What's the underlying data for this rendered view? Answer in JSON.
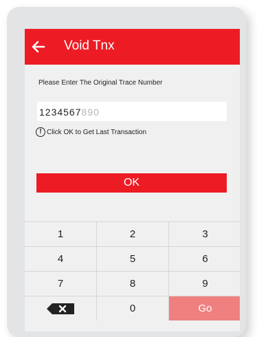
{
  "header": {
    "title": "Void Tnx",
    "back_icon": "arrow-left-icon",
    "color": "#ed1c24"
  },
  "form": {
    "prompt": "Please Enter The Original Trace Number",
    "value": "1234567",
    "placeholder_tail": "890",
    "hint_icon": "exclamation-circle-icon",
    "hint_mark": "!",
    "hint": "Click OK to Get Last Transaction"
  },
  "ok_button": {
    "label": "OK"
  },
  "keypad": {
    "keys": [
      "1",
      "2",
      "3",
      "4",
      "5",
      "6",
      "7",
      "8",
      "9"
    ],
    "backspace_icon": "backspace-icon",
    "zero": "0",
    "go": "Go",
    "go_color": "#f08080"
  }
}
